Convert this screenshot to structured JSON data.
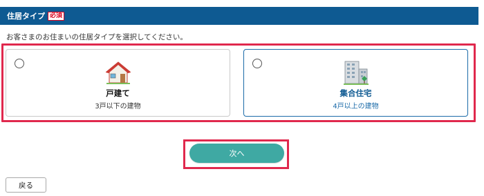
{
  "header": {
    "title": "住居タイプ",
    "required_badge": "必須"
  },
  "instruction": "お客さまのお住まいの住居タイプを選択してください。",
  "options": [
    {
      "title": "戸建て",
      "subtitle": "3戸以下の建物",
      "icon": "house-icon",
      "selected": false
    },
    {
      "title": "集合住宅",
      "subtitle": "4戸以上の建物",
      "icon": "apartment-building-icon",
      "selected": false
    }
  ],
  "buttons": {
    "next_label": "次へ",
    "back_label": "戻る"
  },
  "colors": {
    "header_bg": "#0e5a92",
    "required": "#d6001c",
    "highlight": "#e0284d",
    "next_button": "#3fa9a3",
    "selected_border": "#1a6aa8"
  }
}
